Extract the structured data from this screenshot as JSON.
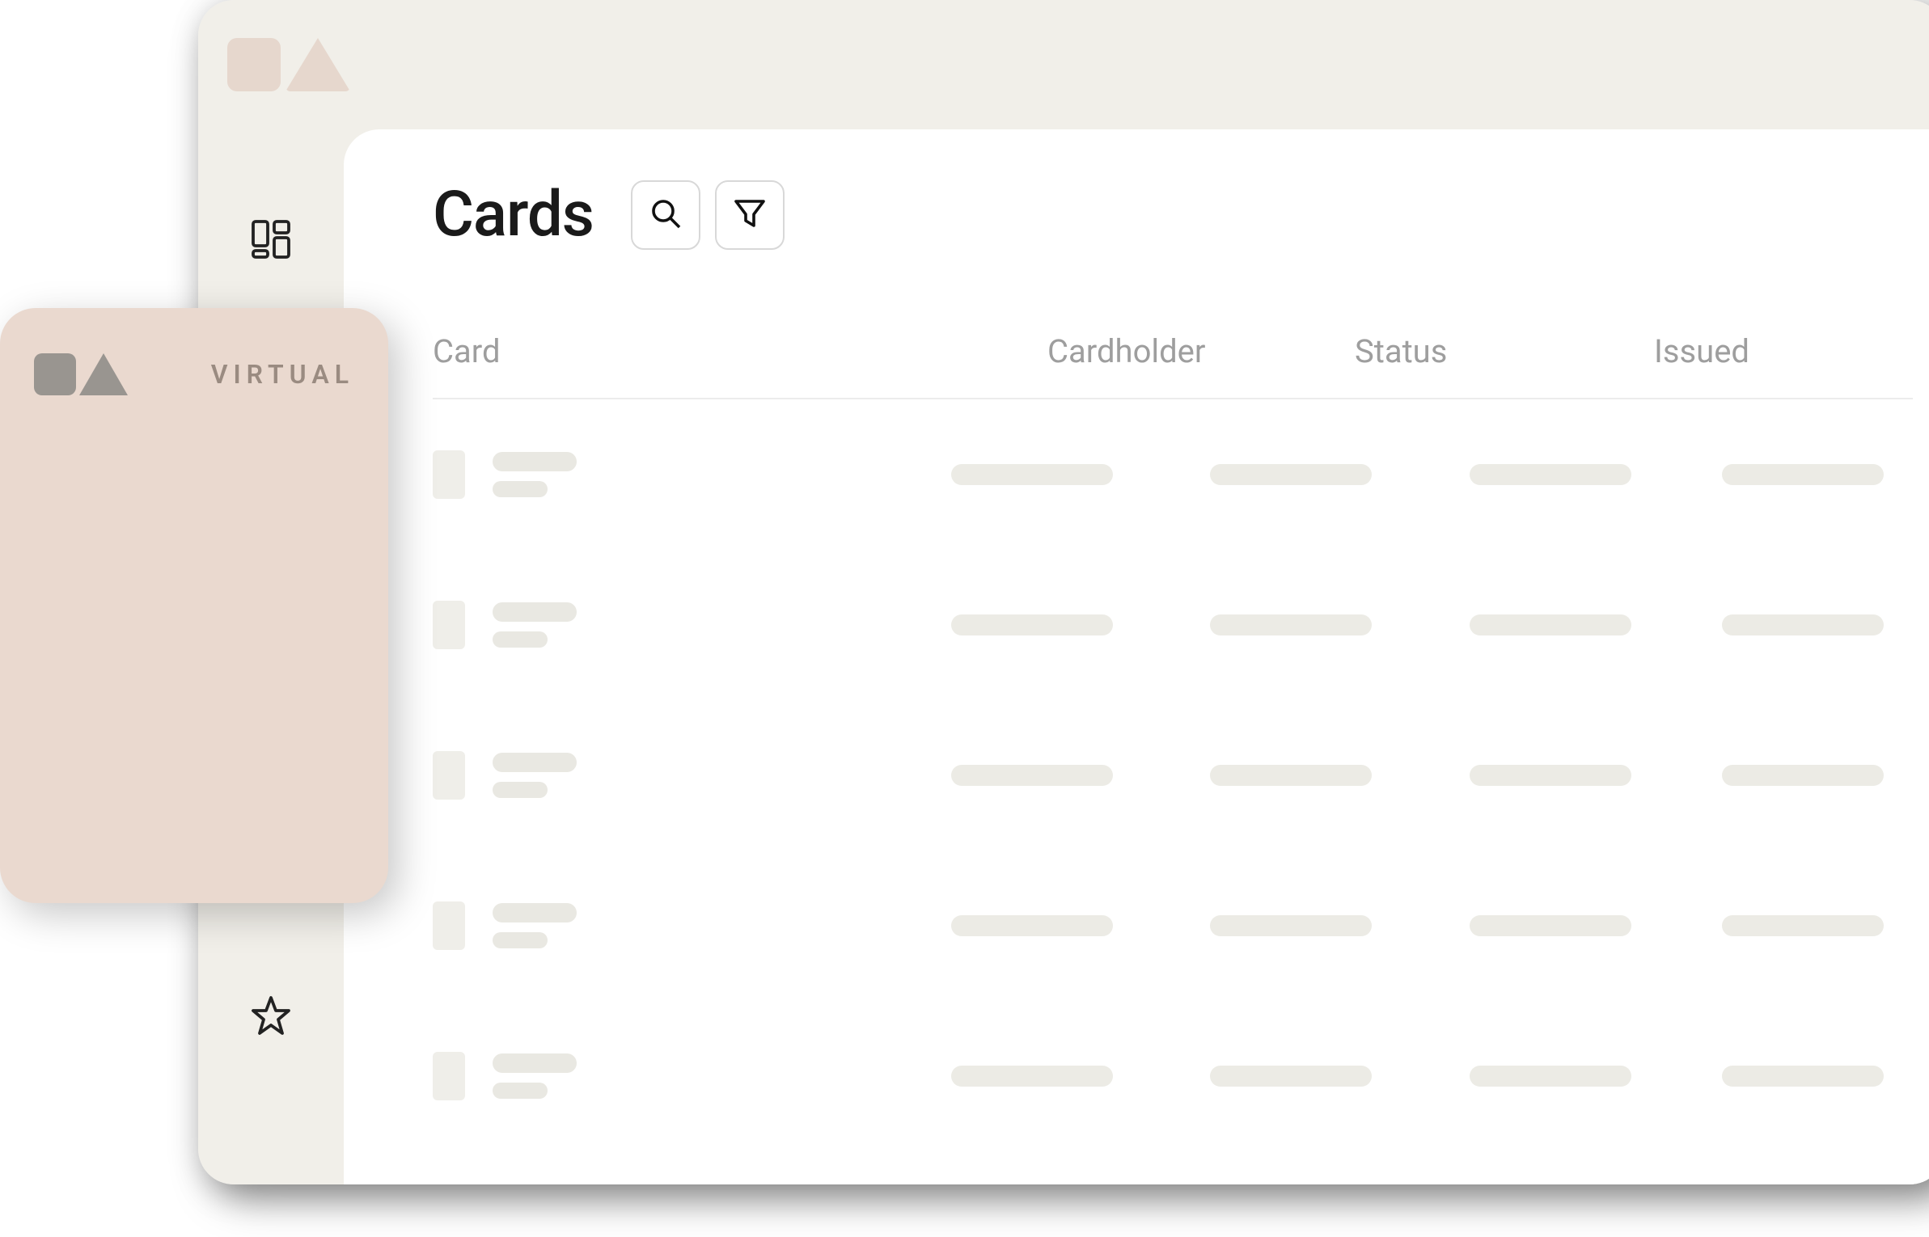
{
  "page_title": "Cards",
  "virtual_card": {
    "label": "VIRTUAL"
  },
  "table": {
    "columns": {
      "card": "Card",
      "cardholder": "Cardholder",
      "status": "Status",
      "issued": "Issued"
    },
    "row_count": 5
  }
}
